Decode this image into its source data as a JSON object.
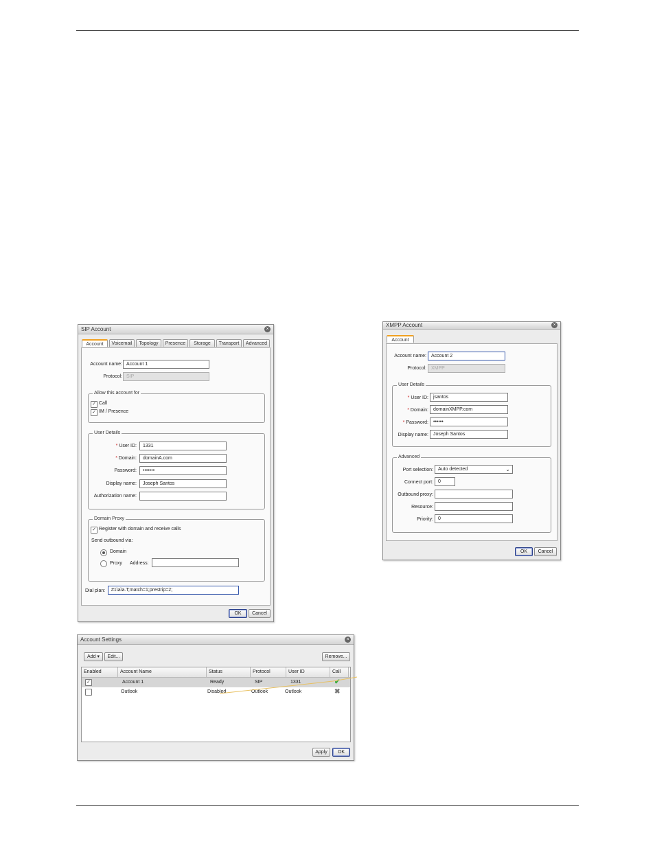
{
  "sip": {
    "title": "SIP Account",
    "tabs": [
      "Account",
      "Voicemail",
      "Topology",
      "Presence",
      "Storage",
      "Transport",
      "Advanced"
    ],
    "account_name_label": "Account name:",
    "account_name": "Account 1",
    "protocol_label": "Protocol:",
    "protocol": "SIP",
    "allow_legend": "Allow this account for",
    "allow_call": "Call",
    "allow_im": "IM / Presence",
    "user_details_legend": "User Details",
    "user_id_label": "User ID:",
    "user_id": "1331",
    "domain_label": "Domain:",
    "domain": "domainA.com",
    "password_label": "Password:",
    "password": "•••••••",
    "display_name_label": "Display name:",
    "display_name": "Joseph Santos",
    "auth_name_label": "Authorization name:",
    "auth_name": "",
    "proxy_legend": "Domain Proxy",
    "register_label": "Register with domain and receive calls",
    "send_outbound_label": "Send outbound via:",
    "domain_radio": "Domain",
    "proxy_radio": "Proxy",
    "address_label": "Address:",
    "address": "",
    "dial_plan_label": "Dial plan:",
    "dial_plan": "#1\\a\\a.T;match=1;prestrip=2;",
    "ok": "OK",
    "cancel": "Cancel"
  },
  "xmpp": {
    "title": "XMPP Account",
    "tab": "Account",
    "account_name_label": "Account name:",
    "account_name": "Account 2",
    "protocol_label": "Protocol:",
    "protocol": "XMPP",
    "user_details_legend": "User Details",
    "user_id_label": "User ID:",
    "user_id": "jsantos",
    "domain_label": "Domain:",
    "domain": "domainXMPP.com",
    "password_label": "Password:",
    "password": "••••••",
    "display_name_label": "Display name:",
    "display_name": "Joseph Santos",
    "advanced_legend": "Advanced",
    "port_selection_label": "Port selection:",
    "port_selection": "Auto detected",
    "connect_port_label": "Connect port:",
    "connect_port": "0",
    "outbound_proxy_label": "Outbound proxy:",
    "outbound_proxy": "",
    "resource_label": "Resource:",
    "resource": "",
    "priority_label": "Priority:",
    "priority": "0",
    "ok": "OK",
    "cancel": "Cancel"
  },
  "settings": {
    "title": "Account Settings",
    "add": "Add",
    "edit": "Edit...",
    "remove": "Remove...",
    "columns": [
      "Enabled",
      "Account Name",
      "Status",
      "Protocol",
      "User ID",
      "Call"
    ],
    "rows": [
      {
        "enabled": true,
        "name": "Account 1",
        "status": "Ready",
        "protocol": "SIP",
        "user_id": "1331",
        "call": "enabled"
      },
      {
        "enabled": false,
        "name": "Outlook",
        "status": "Disabled",
        "protocol": "Outlook",
        "user_id": "Outlook",
        "call": "disabled"
      }
    ],
    "apply": "Apply",
    "ok": "OK"
  },
  "colors": {
    "tab_accent": "#f0a020",
    "ok_icon": "#3aaa3a",
    "annotation": "#e8c060"
  }
}
